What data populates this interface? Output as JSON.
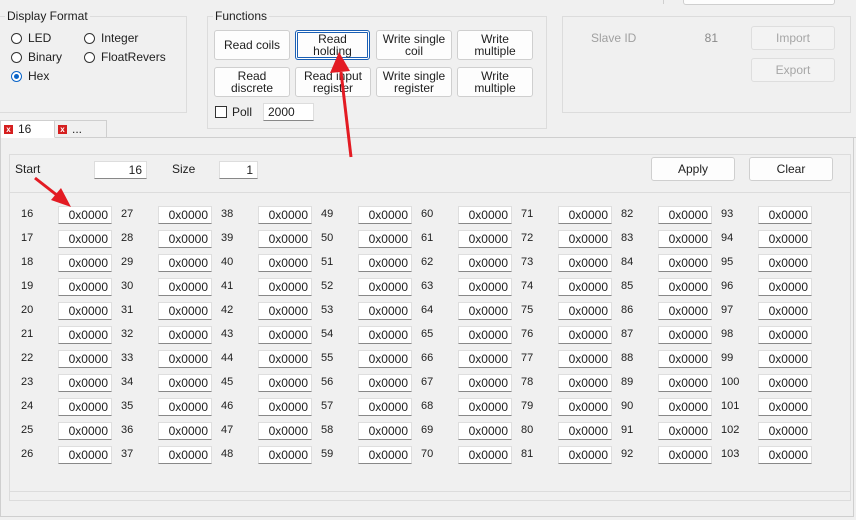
{
  "display_format": {
    "title": "Display Format",
    "options": [
      {
        "label": "LED",
        "selected": false
      },
      {
        "label": "Integer",
        "selected": false
      },
      {
        "label": "Binary",
        "selected": false
      },
      {
        "label": "FloatRevers",
        "selected": false
      },
      {
        "label": "Hex",
        "selected": true
      }
    ]
  },
  "functions": {
    "title": "Functions",
    "buttons": [
      {
        "label": "Read coils"
      },
      {
        "label": "Read\nholding"
      },
      {
        "label": "Write single\ncoil"
      },
      {
        "label": "Write\nmultiple"
      },
      {
        "label": "Read\ndiscrete"
      },
      {
        "label": "Read input\nregister"
      },
      {
        "label": "Write single\nregister"
      },
      {
        "label": "Write\nmultiple"
      }
    ],
    "poll_label": "Poll",
    "poll_value": "2000",
    "poll_checked": false
  },
  "connection": {
    "slave_id_label": "Slave ID",
    "slave_id_value": "81",
    "import_label": "Import",
    "export_label": "Export"
  },
  "tabs": [
    {
      "label": "16"
    },
    {
      "label": "..."
    }
  ],
  "register_panel": {
    "start_label": "Start",
    "start_value": "16",
    "size_label": "Size",
    "size_value": "1",
    "apply_label": "Apply",
    "clear_label": "Clear",
    "columns": [
      {
        "numbers": [
          "16",
          "17",
          "18",
          "19",
          "20",
          "21",
          "22",
          "23",
          "24",
          "25",
          "26"
        ]
      },
      {
        "numbers": [
          "27",
          "28",
          "29",
          "30",
          "31",
          "32",
          "33",
          "34",
          "35",
          "36",
          "37"
        ]
      },
      {
        "numbers": [
          "38",
          "39",
          "40",
          "41",
          "42",
          "43",
          "44",
          "45",
          "46",
          "47",
          "48"
        ]
      },
      {
        "numbers": [
          "49",
          "50",
          "51",
          "52",
          "53",
          "54",
          "55",
          "56",
          "57",
          "58",
          "59"
        ]
      },
      {
        "numbers": [
          "60",
          "61",
          "62",
          "63",
          "64",
          "65",
          "66",
          "67",
          "68",
          "69",
          "70"
        ]
      },
      {
        "numbers": [
          "71",
          "72",
          "73",
          "74",
          "75",
          "76",
          "77",
          "78",
          "79",
          "80",
          "81"
        ]
      },
      {
        "numbers": [
          "82",
          "83",
          "84",
          "85",
          "86",
          "87",
          "88",
          "89",
          "90",
          "91",
          "92"
        ]
      },
      {
        "numbers": [
          "93",
          "94",
          "95",
          "96",
          "97",
          "98",
          "99",
          "100",
          "101",
          "102",
          "103"
        ]
      }
    ],
    "cell_value": "0x0000"
  },
  "annotations": {
    "arrow_color": "#e31b23"
  }
}
